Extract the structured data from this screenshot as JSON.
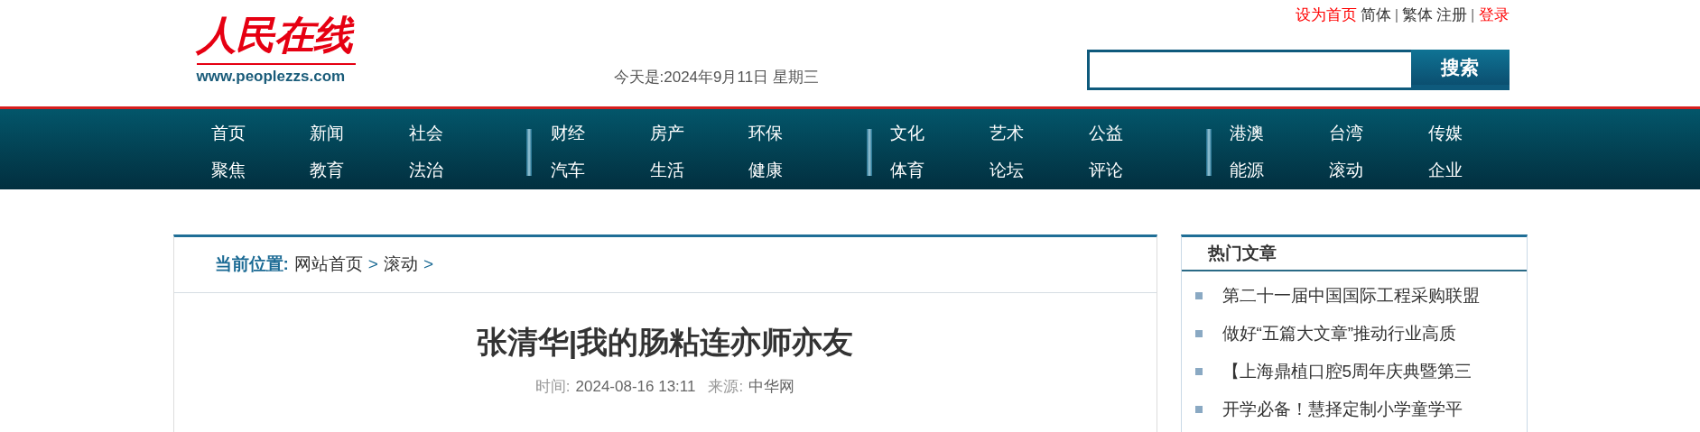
{
  "header": {
    "logo": "人民在线",
    "site_url": "www.peoplezzs.com",
    "date": "今天是:2024年9月11日 星期三",
    "top_links": [
      {
        "label": "设为首页",
        "kind": "highlight"
      },
      {
        "label": "简体",
        "kind": "plain"
      },
      {
        "label": "|",
        "kind": "separator"
      },
      {
        "label": "繁体",
        "kind": "plain"
      },
      {
        "label": "注册",
        "kind": "plain"
      },
      {
        "label": "|",
        "kind": "separator"
      },
      {
        "label": "登录",
        "kind": "highlight"
      }
    ],
    "search": {
      "button": "搜索"
    }
  },
  "nav": {
    "rows": [
      [
        "首页",
        "新闻",
        "社会",
        "财经",
        "房产",
        "环保",
        "文化",
        "艺术",
        "公益",
        "港澳",
        "台湾",
        "传媒"
      ],
      [
        "聚焦",
        "教育",
        "法治",
        "汽车",
        "生活",
        "健康",
        "体育",
        "论坛",
        "评论",
        "能源",
        "滚动",
        "企业"
      ]
    ]
  },
  "breadcrumb": {
    "label": "当前位置:",
    "items": [
      "网站首页",
      "滚动"
    ],
    "separator": ">"
  },
  "article": {
    "title": "张清华|我的肠粘连亦师亦友",
    "time_label": "时间:",
    "time": "2024-08-16 13:11",
    "source_label": "来源:",
    "source": "中华网"
  },
  "sidebar": {
    "title": "热门文章",
    "items": [
      "第二十一届中国国际工程采购联盟",
      "做好“五篇大文章”推动行业高质",
      "【上海鼎植口腔5周年庆典暨第三",
      "开学必备！慧择定制小学童学平"
    ]
  }
}
